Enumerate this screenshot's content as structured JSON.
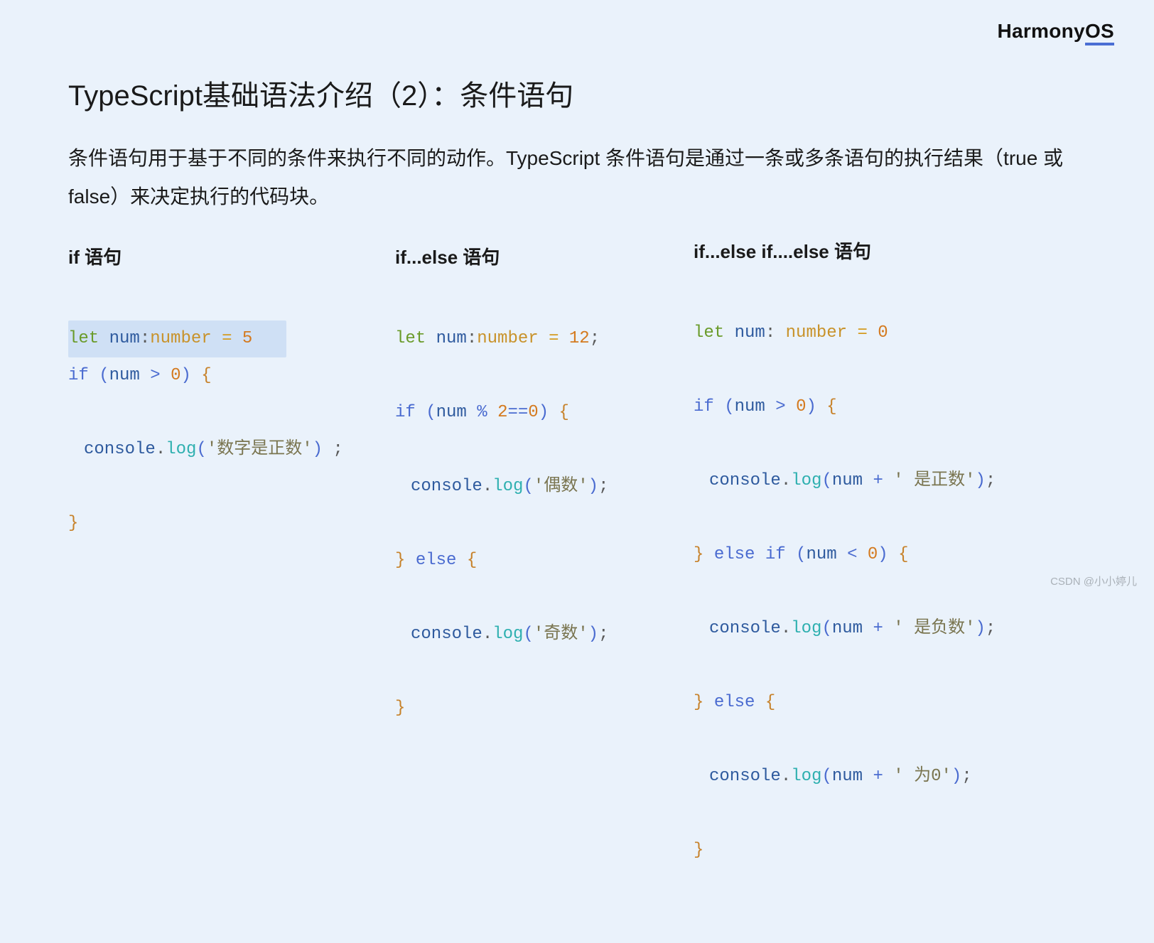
{
  "brand": {
    "prefix": "Harmony",
    "suffix": "OS"
  },
  "title": "TypeScript基础语法介绍（2）：条件语句",
  "description": "条件语句用于基于不同的条件来执行不同的动作。TypeScript 条件语句是通过一条或多条语句的执行结果（true 或 false）来决定执行的代码块。",
  "columns": {
    "col1": {
      "heading": "if 语句",
      "code": {
        "l1": {
          "let": "let",
          "sp": " ",
          "ident": "num",
          "colon": ":",
          "type": "number",
          "sp2": " ",
          "eq": "=",
          "sp3": " ",
          "val": "5"
        },
        "l2": {
          "if": "if",
          "sp": " ",
          "lp": "(",
          "ident": "num",
          "sp2": " ",
          "op": ">",
          "sp3": " ",
          "zero": "0",
          "rp": ")",
          "sp4": " ",
          "lb": "{"
        },
        "l3": {
          "obj": "console",
          "dot": ".",
          "m": "log",
          "lp": "(",
          "q1": "'",
          "s": "数字是正数",
          "q2": "'",
          "rp": ")",
          "sp": " ",
          "semi": ";"
        },
        "l4": {
          "rb": "}"
        }
      }
    },
    "col2": {
      "heading": "if...else 语句",
      "code": {
        "l1": {
          "let": "let",
          "sp": " ",
          "ident": "num",
          "colon": ":",
          "type": "number",
          "sp2": " ",
          "eq": "=",
          "sp3": " ",
          "val": "12",
          "semi": ";"
        },
        "l2": {
          "if": "if",
          "sp": " ",
          "lp": "(",
          "ident": "num",
          "sp2": " ",
          "mod": "%",
          "sp3": " ",
          "two": "2",
          "eqeq": "==",
          "zero": "0",
          "rp": ")",
          "sp4": " ",
          "lb": "{"
        },
        "l3": {
          "obj": "console",
          "dot": ".",
          "m": "log",
          "lp": "(",
          "q1": "'",
          "s": "偶数",
          "q2": "'",
          "rp": ")",
          "semi": ";"
        },
        "l4": {
          "rb": "}",
          "sp": " ",
          "else": "else",
          "sp2": " ",
          "lb": "{"
        },
        "l5": {
          "obj": "console",
          "dot": ".",
          "m": "log",
          "lp": "(",
          "q1": "'",
          "s": "奇数",
          "q2": "'",
          "rp": ")",
          "semi": ";"
        },
        "l6": {
          "rb": "}"
        }
      }
    },
    "col3": {
      "heading": "if...else if....else 语句",
      "code": {
        "l1": {
          "let": "let",
          "sp": " ",
          "ident": "num",
          "colon": ":",
          "sp2": " ",
          "type": "number",
          "sp3": " ",
          "eq": "=",
          "sp4": " ",
          "val": "0"
        },
        "l2": {
          "if": "if",
          "sp": " ",
          "lp": "(",
          "ident": "num",
          "sp2": " ",
          "op": ">",
          "sp3": " ",
          "zero": "0",
          "rp": ")",
          "sp4": " ",
          "lb": "{"
        },
        "l3": {
          "obj": "console",
          "dot": ".",
          "m": "log",
          "lp": "(",
          "ident": "num",
          "sp": " ",
          "plus": "+",
          "sp2": " ",
          "q1": "'",
          "s": " 是正数",
          "q2": "'",
          "rp": ")",
          "semi": ";"
        },
        "l4": {
          "rb": "}",
          "sp": " ",
          "else": "else",
          "sp2": " ",
          "if": "if",
          "sp3": " ",
          "lp": "(",
          "ident": "num",
          "sp4": " ",
          "op": "<",
          "sp5": " ",
          "zero": "0",
          "rp": ")",
          "sp6": " ",
          "lb": "{"
        },
        "l5": {
          "obj": "console",
          "dot": ".",
          "m": "log",
          "lp": "(",
          "ident": "num",
          "sp": " ",
          "plus": "+",
          "sp2": " ",
          "q1": "'",
          "s": " 是负数",
          "q2": "'",
          "rp": ")",
          "semi": ";"
        },
        "l6": {
          "rb": "}",
          "sp": " ",
          "else": "else",
          "sp2": " ",
          "lb": "{"
        },
        "l7": {
          "obj": "console",
          "dot": ".",
          "m": "log",
          "lp": "(",
          "ident": "num",
          "sp": " ",
          "plus": "+",
          "sp2": " ",
          "q1": "'",
          "s": " 为0",
          "q2": "'",
          "rp": ")",
          "semi": ";"
        },
        "l8": {
          "rb": "}"
        }
      }
    }
  },
  "watermark": "CSDN @小小婷儿"
}
